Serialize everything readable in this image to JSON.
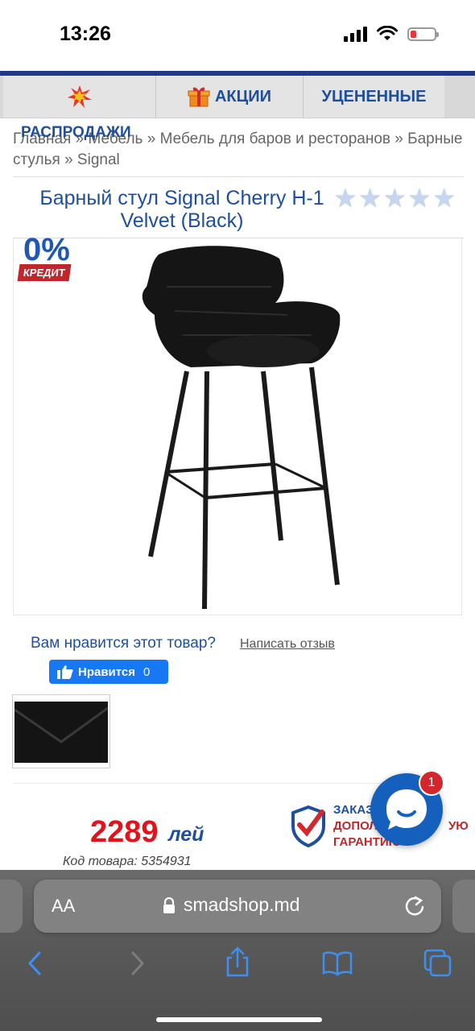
{
  "status": {
    "time": "13:26"
  },
  "nav": {
    "items": [
      "",
      "АКЦИИ",
      "УЦЕНЕННЫЕ"
    ],
    "sale_label": "РАСПРОДАЖИ"
  },
  "breadcrumb": {
    "items": [
      "Главная",
      "Мебель",
      "Мебель для баров и ресторанов",
      "Барные стулья",
      "Signal"
    ],
    "separator": "»"
  },
  "product": {
    "title": "Барный стул Signal Cherry H-1 Velvet (Black)",
    "rating": 0,
    "credit_percent": "0%",
    "credit_label": "КРЕДИТ",
    "price": "2289",
    "currency": "лей",
    "code": "Код товара: 5354931"
  },
  "social": {
    "question": "Вам нравится этот товар?",
    "review_link": "Написать отзыв",
    "like_label": "Нравится",
    "like_count": "0"
  },
  "guarantee": {
    "line1": "ЗАКАЗ",
    "line2": "ДОПОЛ",
    "line2_tail": "УЮ",
    "line3": "ГАРАНТИЮ"
  },
  "chat": {
    "badge": "1"
  },
  "browser": {
    "aa": "AA",
    "url": "smadshop.md"
  }
}
